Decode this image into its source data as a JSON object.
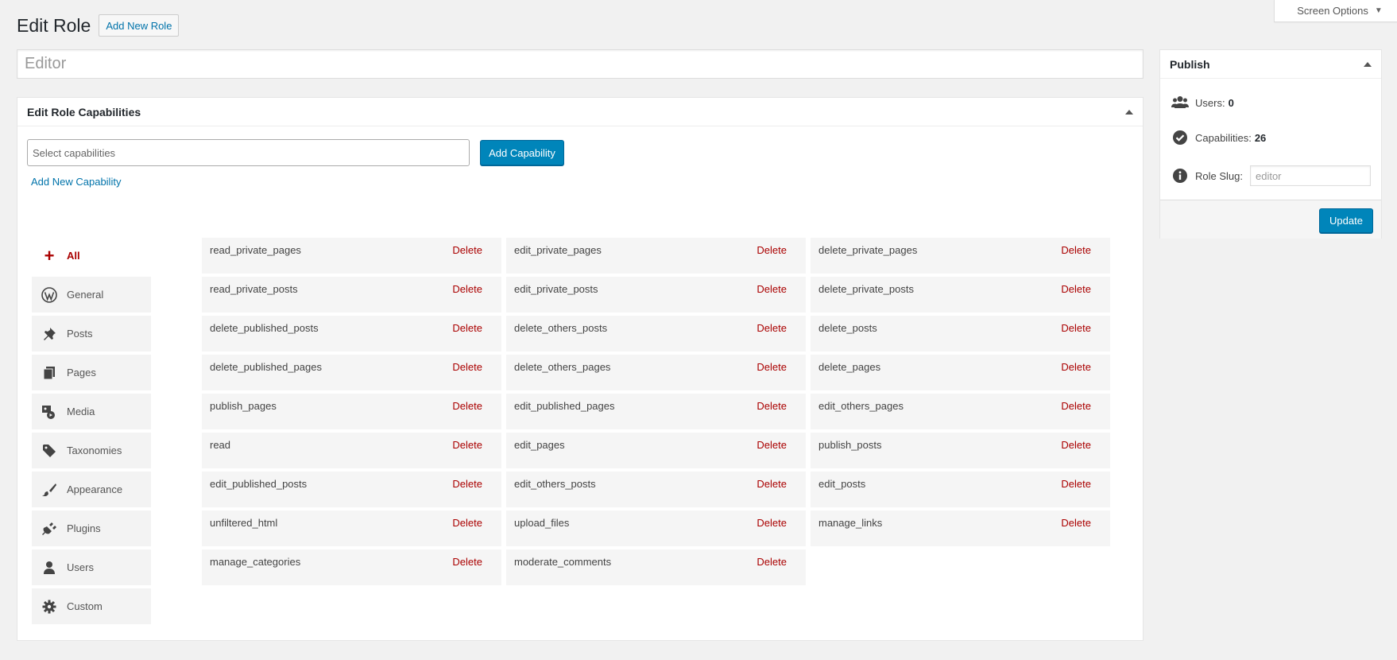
{
  "screen_options": {
    "label": "Screen Options"
  },
  "header": {
    "title": "Edit Role",
    "add_new_label": "Add New Role"
  },
  "role_name": {
    "value": "Editor"
  },
  "capabilities_box": {
    "title": "Edit Role Capabilities",
    "select_placeholder": "Select capabilities",
    "add_button": "Add Capability",
    "add_new_link": "Add New Capability"
  },
  "categories": [
    {
      "label": "All",
      "icon": "plus-icon",
      "active": true
    },
    {
      "label": "General",
      "icon": "wordpress-icon"
    },
    {
      "label": "Posts",
      "icon": "pushpin-icon"
    },
    {
      "label": "Pages",
      "icon": "pages-icon"
    },
    {
      "label": "Media",
      "icon": "media-icon"
    },
    {
      "label": "Taxonomies",
      "icon": "tag-icon"
    },
    {
      "label": "Appearance",
      "icon": "paintbrush-icon"
    },
    {
      "label": "Plugins",
      "icon": "plugin-icon"
    },
    {
      "label": "Users",
      "icon": "user-icon"
    },
    {
      "label": "Custom",
      "icon": "gear-icon"
    }
  ],
  "delete_label": "Delete",
  "capabilities": [
    "read_private_pages",
    "edit_private_pages",
    "delete_private_pages",
    "read_private_posts",
    "edit_private_posts",
    "delete_private_posts",
    "delete_published_posts",
    "delete_others_posts",
    "delete_posts",
    "delete_published_pages",
    "delete_others_pages",
    "delete_pages",
    "publish_pages",
    "edit_published_pages",
    "edit_others_pages",
    "read",
    "edit_pages",
    "publish_posts",
    "edit_published_posts",
    "edit_others_posts",
    "edit_posts",
    "unfiltered_html",
    "upload_files",
    "manage_links",
    "manage_categories",
    "moderate_comments"
  ],
  "publish": {
    "title": "Publish",
    "users_label": "Users:",
    "users_count": "0",
    "caps_label": "Capabilities:",
    "caps_count": "26",
    "slug_label": "Role Slug:",
    "slug_value": "editor",
    "update_button": "Update"
  }
}
